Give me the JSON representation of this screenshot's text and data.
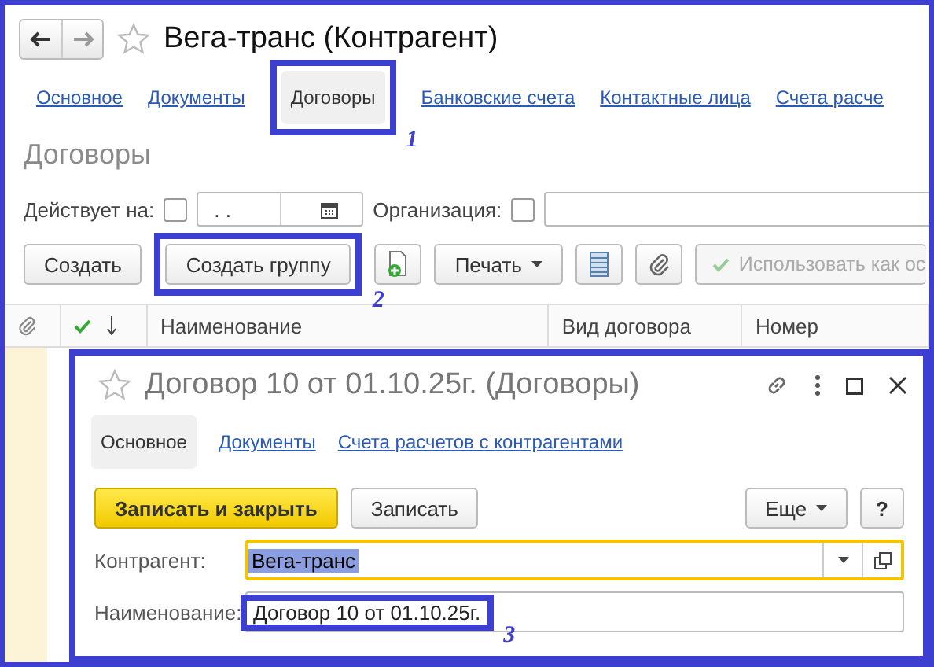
{
  "window": {
    "title": "Вега-транс (Контрагент)",
    "favorite": false
  },
  "tabs": [
    {
      "label": "Основное",
      "selected": false
    },
    {
      "label": "Документы",
      "selected": false
    },
    {
      "label": "Договоры",
      "selected": true,
      "annotation": "1"
    },
    {
      "label": "Банковские счета",
      "selected": false
    },
    {
      "label": "Контактные лица",
      "selected": false
    },
    {
      "label": "Счета расче",
      "selected": false
    }
  ],
  "section_title": "Договоры",
  "filters": [
    {
      "label": "Действует на:",
      "checked": false,
      "value": " .  .",
      "kind": "date"
    },
    {
      "label": "Организация:",
      "checked": false,
      "kind": "text"
    }
  ],
  "toolbar": [
    {
      "kind": "text",
      "label": "Создать",
      "disabled": false
    },
    {
      "kind": "text",
      "label": "Создать группу",
      "disabled": false,
      "annotation": "2"
    },
    {
      "kind": "add",
      "disabled": false
    },
    {
      "kind": "menu",
      "label": "Печать",
      "disabled": false
    },
    {
      "kind": "list",
      "disabled": false
    },
    {
      "kind": "attach",
      "disabled": false
    },
    {
      "kind": "check",
      "label": "Использовать как ос",
      "disabled": true
    }
  ],
  "table": {
    "columns": [
      {
        "kind": "attach"
      },
      {
        "kind": "check"
      },
      {
        "kind": "text",
        "label": "Наименование"
      },
      {
        "kind": "text",
        "label": "Вид договора"
      },
      {
        "kind": "text",
        "label": "Номер"
      }
    ]
  },
  "dialog": {
    "title": "Договор 10 от 01.10.25г. (Договоры)",
    "favorite": false,
    "tabs": [
      {
        "label": "Основное",
        "selected": true
      },
      {
        "label": "Документы",
        "selected": false
      },
      {
        "label": "Счета расчетов с контрагентами",
        "selected": false
      }
    ],
    "buttons": [
      {
        "kind": "primary",
        "label": "Записать и закрыть"
      },
      {
        "kind": "normal",
        "label": "Записать"
      }
    ],
    "right_buttons": [
      {
        "kind": "menu",
        "label": "Еще"
      },
      {
        "kind": "normal",
        "label": "?"
      }
    ],
    "fields": [
      {
        "kind": "reference",
        "label": "Контрагент:",
        "value": "Вега-транс",
        "focused": true,
        "text_selected": true
      },
      {
        "kind": "text",
        "label": "Наименование:",
        "value": "Договор 10 от 01.10.25г.",
        "focused": false,
        "text_selected": false,
        "annotation": "3"
      }
    ]
  }
}
